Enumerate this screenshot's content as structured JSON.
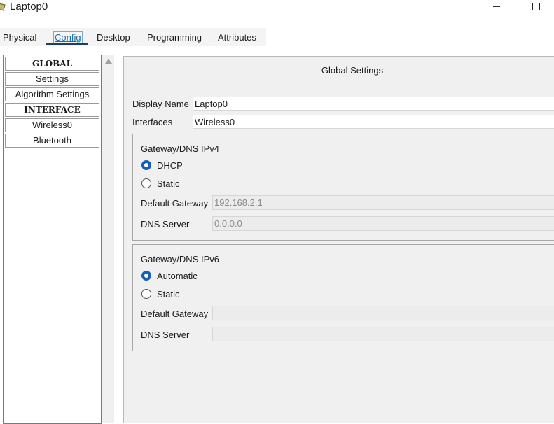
{
  "window": {
    "title": "Laptop0"
  },
  "tabs": [
    {
      "label": "Physical"
    },
    {
      "label": "Config"
    },
    {
      "label": "Desktop"
    },
    {
      "label": "Programming"
    },
    {
      "label": "Attributes"
    }
  ],
  "active_tab": "Config",
  "sidebar": {
    "items": [
      {
        "label": "GLOBAL",
        "type": "header"
      },
      {
        "label": "Settings"
      },
      {
        "label": "Algorithm Settings"
      },
      {
        "label": "INTERFACE",
        "type": "header"
      },
      {
        "label": "Wireless0"
      },
      {
        "label": "Bluetooth"
      }
    ]
  },
  "main": {
    "title": "Global Settings",
    "display_name": {
      "label": "Display Name",
      "value": "Laptop0"
    },
    "interfaces": {
      "label": "Interfaces",
      "value": "Wireless0"
    },
    "ipv4": {
      "title": "Gateway/DNS IPv4",
      "options": [
        {
          "label": "DHCP",
          "checked": true
        },
        {
          "label": "Static",
          "checked": false
        }
      ],
      "gateway_label": "Default Gateway",
      "gateway_value": "192.168.2.1",
      "dns_label": "DNS Server",
      "dns_value": "0.0.0.0"
    },
    "ipv6": {
      "title": "Gateway/DNS IPv6",
      "options": [
        {
          "label": "Automatic",
          "checked": true
        },
        {
          "label": "Static",
          "checked": false
        }
      ],
      "gateway_label": "Default Gateway",
      "gateway_value": "",
      "dns_label": "DNS Server",
      "dns_value": ""
    }
  },
  "colors": {
    "accent": "#1560b8",
    "tab_underline": "#1c3f63"
  }
}
